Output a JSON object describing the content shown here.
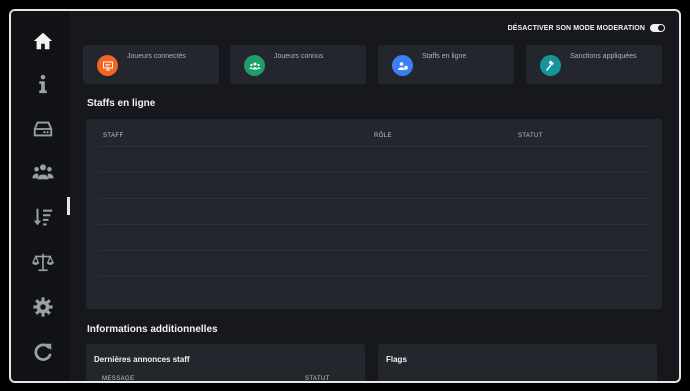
{
  "window": {
    "moderation_toggle_label": "DÉSACTIVER SON MODE MODERATION",
    "moderation_enabled": true
  },
  "sidebar": {
    "items": [
      {
        "icon": "home-icon",
        "active": true
      },
      {
        "icon": "info-icon"
      },
      {
        "icon": "server-icon"
      },
      {
        "icon": "users-icon"
      },
      {
        "icon": "sort-icon"
      },
      {
        "icon": "scale-icon"
      },
      {
        "icon": "gear-icon"
      },
      {
        "icon": "refresh-icon"
      }
    ]
  },
  "stats": [
    {
      "label": "Joueurs connectés",
      "value": "",
      "icon": "monitor-icon",
      "color": "#f26522"
    },
    {
      "label": "Joueurs connus",
      "value": "",
      "icon": "group-icon",
      "color": "#1f9d6b"
    },
    {
      "label": "Staffs en ligne",
      "value": "",
      "icon": "user-shield-icon",
      "color": "#3b7ff2"
    },
    {
      "label": "Sanctions appliquées",
      "value": "",
      "icon": "gavel-icon",
      "color": "#14959c"
    }
  ],
  "staff_section": {
    "title": "Staffs en ligne",
    "columns": [
      "STAFF",
      "RÔLE",
      "STATUT"
    ],
    "rows": []
  },
  "info_section": {
    "title": "Informations additionnelles",
    "announcements": {
      "title": "Dernières annonces staff",
      "columns": [
        "MESSAGE",
        "STATUT"
      ]
    },
    "flags": {
      "title": "Flags"
    }
  },
  "colors": {
    "background": "#16181d",
    "card": "#23262d",
    "sidebar": "#101215"
  }
}
